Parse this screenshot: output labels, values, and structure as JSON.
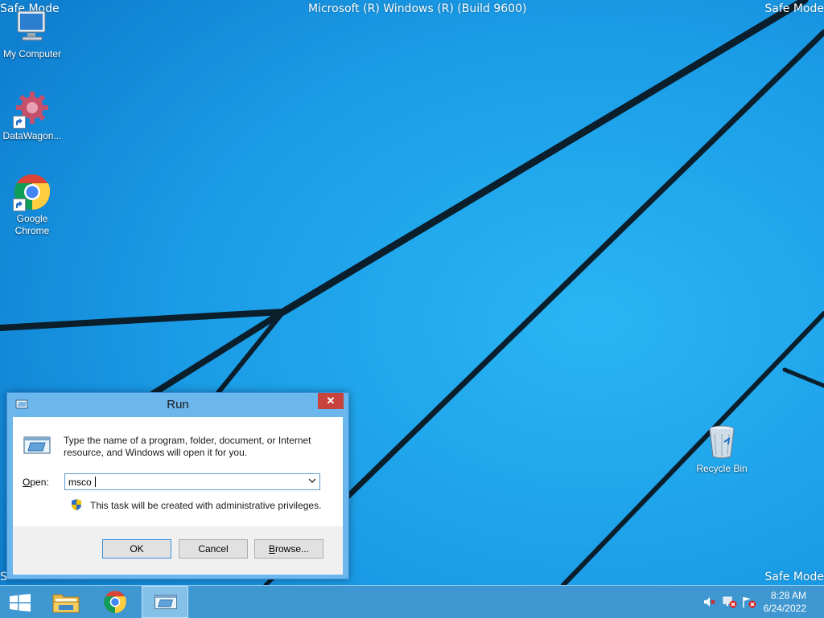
{
  "desktop": {
    "top_left_mode": "Safe Mode",
    "top_right_mode": "Safe Mode",
    "bottom_left_mode": "S",
    "bottom_right_mode": "Safe Mode",
    "build_text": "Microsoft (R) Windows (R) (Build 9600)",
    "icons": [
      {
        "label": "My Computer",
        "icon": "computer-icon"
      },
      {
        "label": "DataWagon...",
        "icon": "gear-icon"
      },
      {
        "label_line1": "Google",
        "label_line2": "Chrome",
        "icon": "chrome-icon"
      },
      {
        "label": "Recycle Bin",
        "icon": "recycle-bin-icon"
      }
    ]
  },
  "run_dialog": {
    "title": "Run",
    "close_symbol": "✕",
    "description": "Type the name of a program, folder, document, or Internet resource, and Windows will open it for you.",
    "open_label_first": "O",
    "open_label_rest": "pen:",
    "open_value": "msco",
    "admin_note": "This task will be created with administrative privileges.",
    "ok_label": "OK",
    "cancel_label": "Cancel",
    "browse_label_first": "B",
    "browse_label_rest": "rowse..."
  },
  "taskbar": {
    "items": [
      "start-icon",
      "file-explorer-icon",
      "chrome-icon",
      "run-icon"
    ],
    "tray": [
      "speaker-muted-icon",
      "network-error-icon",
      "action-center-error-icon"
    ],
    "time": "8:28 AM",
    "date": "6/24/2022"
  },
  "colors": {
    "wallpaper": "#1a9be6",
    "dialog_frame": "#6bb6ec",
    "close_button": "#c7433b",
    "taskbar": "#4696cd"
  }
}
